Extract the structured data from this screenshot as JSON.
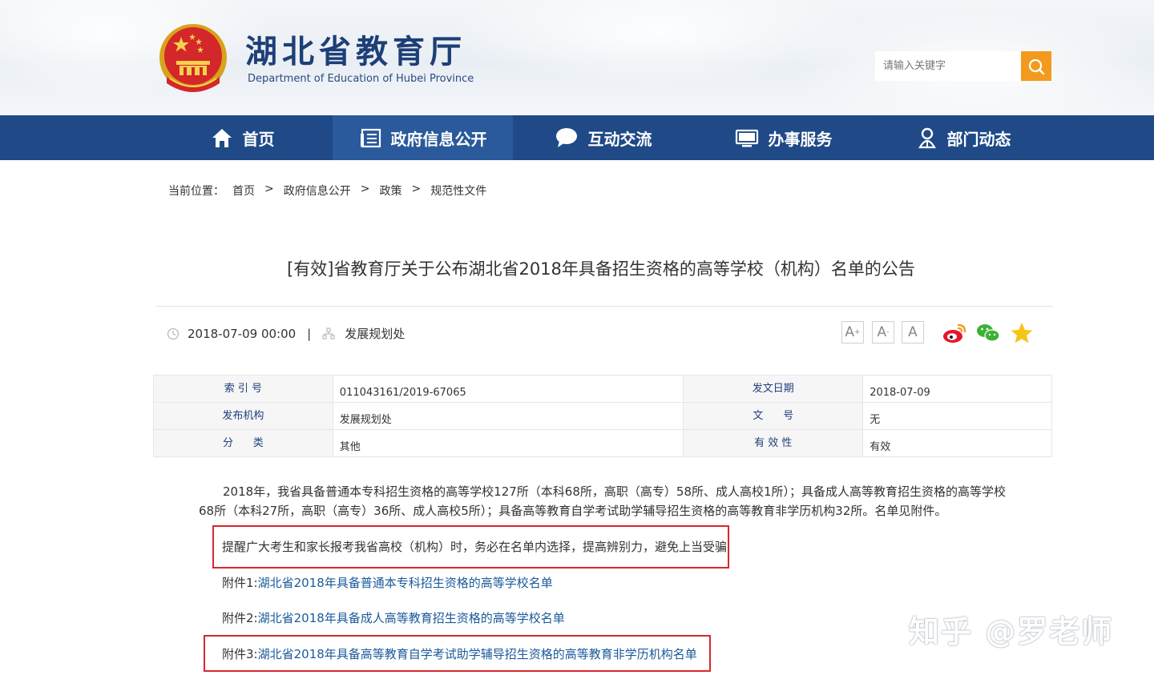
{
  "header": {
    "title": "湖北省教育厅",
    "subtitle": "Department of Education of Hubei Province",
    "search_placeholder": "请输入关键字",
    "emblem_icon": "national-emblem-icon"
  },
  "nav": {
    "items": [
      {
        "label": "首页",
        "icon": "home-icon"
      },
      {
        "label": "政府信息公开",
        "icon": "document-list-icon",
        "active": true
      },
      {
        "label": "互动交流",
        "icon": "chat-bubble-icon"
      },
      {
        "label": "办事服务",
        "icon": "monitor-icon"
      },
      {
        "label": "部门动态",
        "icon": "person-icon"
      }
    ],
    "bg_color": "#1f4a87"
  },
  "breadcrumb": {
    "prefix": "当前位置：",
    "items": [
      "首页",
      "政府信息公开",
      "政策",
      "规范性文件"
    ],
    "separator": ">"
  },
  "article": {
    "title": "[有效]省教育厅关于公布湖北省2018年具备招生资格的高等学校（机构）名单的公告",
    "date": "2018-07-09 00:00",
    "pipe": "|",
    "department": "发展规划处",
    "font_buttons": [
      "A+",
      "A-",
      "A"
    ]
  },
  "info_table": {
    "rows": [
      {
        "l1": "索 引 号",
        "v1": "011043161/2019-67065",
        "l2": "发文日期",
        "v2": "2018-07-09"
      },
      {
        "l1": "发布机构",
        "v1": "发展规划处",
        "l2": "文      号",
        "v2": "无"
      },
      {
        "l1": "分      类",
        "v1": "其他",
        "l2": "有 效 性",
        "v2": "有效"
      }
    ]
  },
  "body": {
    "paragraph": "2018年，我省具备普通本专科招生资格的高等学校127所（本科68所，高职（高专）58所、成人高校1所）；具备成人高等教育招生资格的高等学校68所（本科27所，高职（高专）36所、成人高校5所）；具备高等教育自学考试助学辅导招生资格的高等教育非学历机构32所。名单见附件。",
    "notice": "提醒广大考生和家长报考我省高校（机构）时，务必在名单内选择，提高辨别力，避免上当受骗",
    "attachments": [
      {
        "prefix": "附件1:",
        "link": "湖北省2018年具备普通本专科招生资格的高等学校名单"
      },
      {
        "prefix": "附件2:",
        "link": "湖北省2018年具备成人高等教育招生资格的高等学校名单"
      },
      {
        "prefix": "附件3:",
        "link": "湖北省2018年具备高等教育自学考试助学辅导招生资格的高等教育非学历机构名单"
      }
    ]
  },
  "watermark": "知乎 @罗老师",
  "colors": {
    "highlight_box": "#d4282d",
    "link": "#1a5a9a",
    "search_button": "#f39a1e",
    "title_blue": "#1d3f77"
  }
}
